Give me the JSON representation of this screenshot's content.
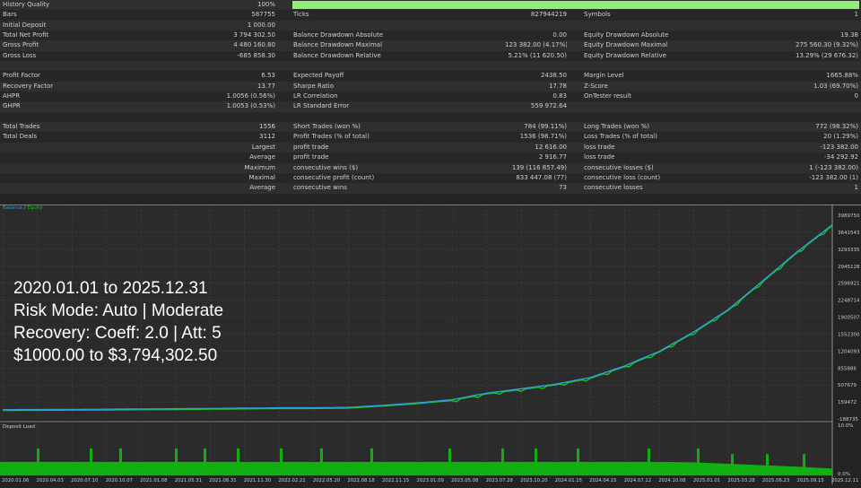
{
  "report": {
    "rows": [
      {
        "l1": "History Quality",
        "v1": "100%",
        "progress": 100
      },
      {
        "l1": "Bars",
        "v1": "587755",
        "l2": "Ticks",
        "v2": "827944219",
        "l3": "Symbols",
        "v3": "1"
      },
      {
        "l1": "Initial Deposit",
        "v1": "1 000.00"
      },
      {
        "l1": "Total Net Profit",
        "v1": "3 794 302.50",
        "l2": "Balance Drawdown Absolute",
        "v2": "0.00",
        "l3": "Equity Drawdown Absolute",
        "v3": "19.38"
      },
      {
        "l1": "Gross Profit",
        "v1": "4 480 160.80",
        "l2": "Balance Drawdown Maximal",
        "v2": "123 382.00 (4.17%)",
        "l3": "Equity Drawdown Maximal",
        "v3": "275 560.30 (9.32%)"
      },
      {
        "l1": "Gross Loss",
        "v1": "-685 858.30",
        "l2": "Balance Drawdown Relative",
        "v2": "5.21% (11 620.50)",
        "l3": "Equity Drawdown Relative",
        "v3": "13.29% (29 676.32)"
      },
      {},
      {
        "l1": "Profit Factor",
        "v1": "6.53",
        "l2": "Expected Payoff",
        "v2": "2438.50",
        "l3": "Margin Level",
        "v3": "1665.88%"
      },
      {
        "l1": "Recovery Factor",
        "v1": "13.77",
        "l2": "Sharpe Ratio",
        "v2": "17.78",
        "l3": "Z-Score",
        "v3": "1.03 (69.70%)"
      },
      {
        "l1": "AHPR",
        "v1": "1.0056 (0.56%)",
        "l2": "LR Correlation",
        "v2": "0.83",
        "l3": "OnTester result",
        "v3": "0"
      },
      {
        "l1": "GHPR",
        "v1": "1.0053 (0.53%)",
        "l2": "LR Standard Error",
        "v2": "559 972.64"
      },
      {},
      {
        "l1": "Total Trades",
        "v1": "1556",
        "l2": "Short Trades (won %)",
        "v2": "784 (99.11%)",
        "l3": "Long Trades (won %)",
        "v3": "772 (98.32%)"
      },
      {
        "l1": "Total Deals",
        "v1": "3112",
        "l2": "Profit Trades (% of total)",
        "v2": "1536 (98.71%)",
        "l3": "Loss Trades (% of total)",
        "v3": "20 (1.29%)"
      },
      {
        "v1": "Largest",
        "l2": "profit trade",
        "v2": "12 616.00",
        "l3": "loss trade",
        "v3": "-123 382.00"
      },
      {
        "v1": "Average",
        "l2": "profit trade",
        "v2": "2 916.77",
        "l3": "loss trade",
        "v3": "-34 292.92"
      },
      {
        "v1": "Maximum",
        "l2": "consecutive wins ($)",
        "v2": "139 (116 857.49)",
        "l3": "consecutive losses ($)",
        "v3": "1 (-123 382.00)"
      },
      {
        "v1": "Maximal",
        "l2": "consecutive profit (count)",
        "v2": "833 447.08 (77)",
        "l3": "consecutive loss (count)",
        "v3": "-123 382.00 (1)"
      },
      {
        "v1": "Average",
        "l2": "consecutive wins",
        "v2": "73",
        "l3": "consecutive losses",
        "v3": "1"
      }
    ]
  },
  "overlay": {
    "line1": "2020.01.01 to 2025.12.31",
    "line2": "Risk Mode: Auto | Moderate",
    "line3": "Recovery: Coeff: 2.0 | Att: 5",
    "line4": "$1000.00 to $3,794,302.50"
  },
  "colors": {
    "balance": "#2f9fd8",
    "equity": "#1fc21f",
    "load": "#10b010",
    "progress": "#8cf07a"
  },
  "chart_data": [
    {
      "type": "line",
      "legend": {
        "balance": "Balance",
        "sep": " / ",
        "equity": "Equity"
      },
      "legend_position": "top-left",
      "x": [
        "2020.01.06",
        "2020.04.03",
        "2020.07.10",
        "2020.10.07",
        "2021.01.08",
        "2021.05.31",
        "2021.08.31",
        "2021.11.30",
        "2022.02.21",
        "2022.05.20",
        "2022.08.18",
        "2022.11.15",
        "2023.01.09",
        "2023.05.08",
        "2023.07.28",
        "2023.10.20",
        "2024.01.15",
        "2024.04.15",
        "2024.07.12",
        "2024.10.08",
        "2025.01.01",
        "2025.03.28",
        "2025.06.23",
        "2025.09.15",
        "2025.12.11"
      ],
      "series": [
        {
          "name": "Balance",
          "values": [
            1000,
            3000,
            6000,
            10000,
            15000,
            20000,
            26000,
            32000,
            39000,
            40000,
            48000,
            90000,
            140000,
            205000,
            340000,
            430000,
            525000,
            660000,
            900000,
            1200000,
            1600000,
            2060000,
            2650000,
            3250000,
            3795302
          ]
        }
      ],
      "yticks": [
        "3989750",
        "3641543",
        "3293335",
        "2945128",
        "2596921",
        "2248714",
        "1900507",
        "1552300",
        "1204093",
        "855886",
        "507679",
        "159472",
        "-188735"
      ],
      "ylim": [
        -188735,
        3989750
      ],
      "grid": true
    },
    {
      "type": "bar",
      "title": "Deposit Load",
      "yticks": [
        "10.0%",
        "0.0%"
      ],
      "ylim": [
        0,
        10
      ],
      "base_load": [
        2.8,
        2.8,
        2.8,
        2.8,
        2.8,
        2.8,
        2.8,
        2.8,
        2.8,
        2.8,
        2.8,
        2.8,
        2.8,
        2.8,
        2.8,
        2.8,
        2.8,
        2.8,
        2.8,
        2.8,
        2.7,
        2.4,
        2.1,
        1.8,
        1.4
      ],
      "spike_load": 5.6
    }
  ]
}
